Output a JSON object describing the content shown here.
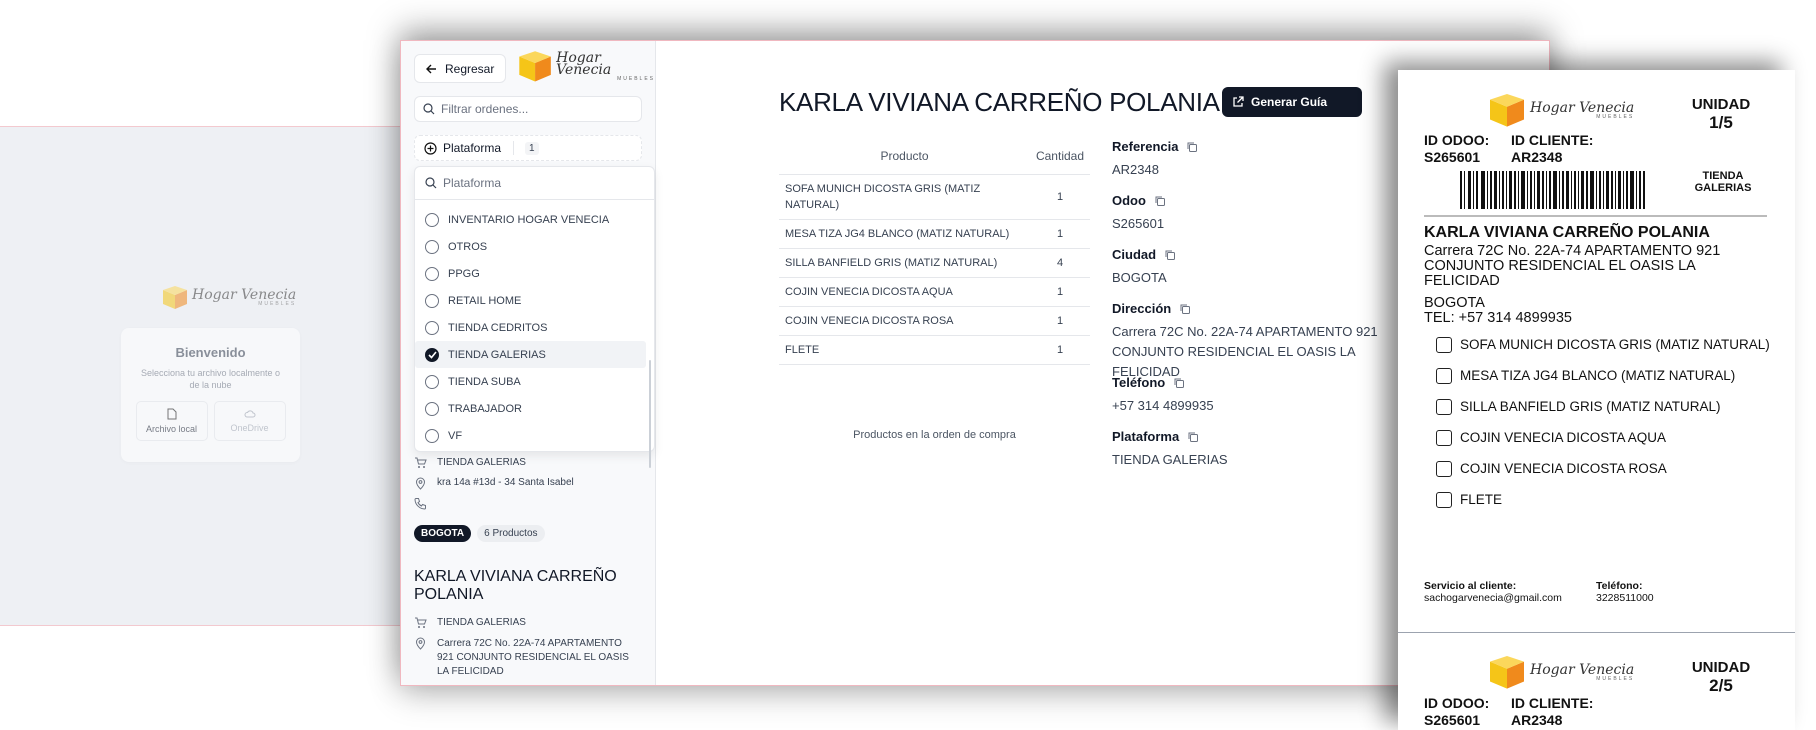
{
  "brand": {
    "name": "Hogar Venecia",
    "sub": "MUEBLES"
  },
  "login": {
    "title": "Bienvenido",
    "subtitle": "Selecciona tu archivo localmente o de la nube",
    "local_label": "Archivo local",
    "cloud_label": "OneDrive"
  },
  "sidebar": {
    "back_label": "Regresar",
    "filter_placeholder": "Filtrar ordenes...",
    "platform_label": "Plataforma",
    "platform_count": "1",
    "dropdown": {
      "search_placeholder": "Plataforma",
      "options": [
        {
          "label": "INVENTARIO HOGAR VENECIA",
          "checked": false
        },
        {
          "label": "OTROS",
          "checked": false
        },
        {
          "label": "PPGG",
          "checked": false
        },
        {
          "label": "RETAIL HOME",
          "checked": false
        },
        {
          "label": "TIENDA CEDRITOS",
          "checked": false
        },
        {
          "label": "TIENDA GALERIAS",
          "checked": true
        },
        {
          "label": "TIENDA SUBA",
          "checked": false
        },
        {
          "label": "TRABAJADOR",
          "checked": false
        },
        {
          "label": "VF",
          "checked": false
        }
      ]
    },
    "prev_order": {
      "store": "TIENDA GALERIAS",
      "address": "kra 14a #13d - 34 Santa Isabel",
      "phone": "",
      "city_badge": "BOGOTA",
      "products_badge": "6 Productos"
    },
    "current_order": {
      "name": "KARLA VIVIANA CARREÑO POLANIA",
      "store": "TIENDA GALERIAS",
      "address": "Carrera 72C No. 22A-74 APARTAMENTO 921 CONJUNTO RESIDENCIAL EL OASIS LA FELICIDAD"
    }
  },
  "main": {
    "title": "KARLA VIVIANA CARREÑO POLANIA",
    "generate_label": "Generar Guía",
    "table": {
      "headers": {
        "product": "Producto",
        "qty": "Cantidad"
      },
      "rows": [
        {
          "product": "SOFA MUNICH DICOSTA GRIS (MATIZ NATURAL)",
          "qty": "1"
        },
        {
          "product": "MESA TIZA JG4 BLANCO (MATIZ NATURAL)",
          "qty": "1"
        },
        {
          "product": "SILLA BANFIELD GRIS (MATIZ NATURAL)",
          "qty": "4"
        },
        {
          "product": "COJIN VENECIA DICOSTA AQUA",
          "qty": "1"
        },
        {
          "product": "COJIN VENECIA DICOSTA ROSA",
          "qty": "1"
        },
        {
          "product": "FLETE",
          "qty": "1"
        }
      ],
      "caption": "Productos en la orden de compra"
    },
    "details": {
      "referencia_label": "Referencia",
      "referencia": "AR2348",
      "odoo_label": "Odoo",
      "odoo": "S265601",
      "ciudad_label": "Ciudad",
      "ciudad": "BOGOTA",
      "direccion_label": "Dirección",
      "direccion": "Carrera 72C No. 22A-74 APARTAMENTO 921 CONJUNTO RESIDENCIAL EL OASIS LA FELICIDAD",
      "telefono_label": "Teléfono",
      "telefono": "+57 314 4899935",
      "plataforma_label": "Plataforma",
      "plataforma": "TIENDA GALERIAS"
    }
  },
  "label": {
    "unit_label": "UNIDAD",
    "unit_1": "1/5",
    "unit_2": "2/5",
    "odoo_label": "ID ODOO:",
    "odoo_id": "S265601",
    "client_label": "ID CLIENTE:",
    "client_id": "AR2348",
    "store": "TIENDA GALERIAS",
    "name": "KARLA VIVIANA CARREÑO POLANIA",
    "address": "Carrera 72C No. 22A-74 APARTAMENTO 921 CONJUNTO RESIDENCIAL EL OASIS LA FELICIDAD",
    "city": "BOGOTA",
    "tel": "TEL: +57 314 4899935",
    "items": [
      "SOFA MUNICH DICOSTA GRIS (MATIZ NATURAL)",
      "MESA TIZA JG4 BLANCO (MATIZ NATURAL)",
      "SILLA BANFIELD GRIS (MATIZ NATURAL)",
      "COJIN VENECIA DICOSTA AQUA",
      "COJIN VENECIA DICOSTA ROSA",
      "FLETE"
    ],
    "service_label": "Servicio al cliente:",
    "service_email": "sachogarvenecia@gmail.com",
    "phone_label": "Teléfono:",
    "phone": "3228511000"
  },
  "colors": {
    "logo_yellow": "#F5C518",
    "logo_orange": "#F08A1C",
    "primary": "#111827"
  },
  "icons": [
    "arrow-left-icon",
    "search-icon",
    "plus-circle-icon",
    "check-icon",
    "cart-icon",
    "map-pin-icon",
    "phone-icon",
    "external-link-icon",
    "copy-icon",
    "file-icon",
    "cloud-icon"
  ]
}
